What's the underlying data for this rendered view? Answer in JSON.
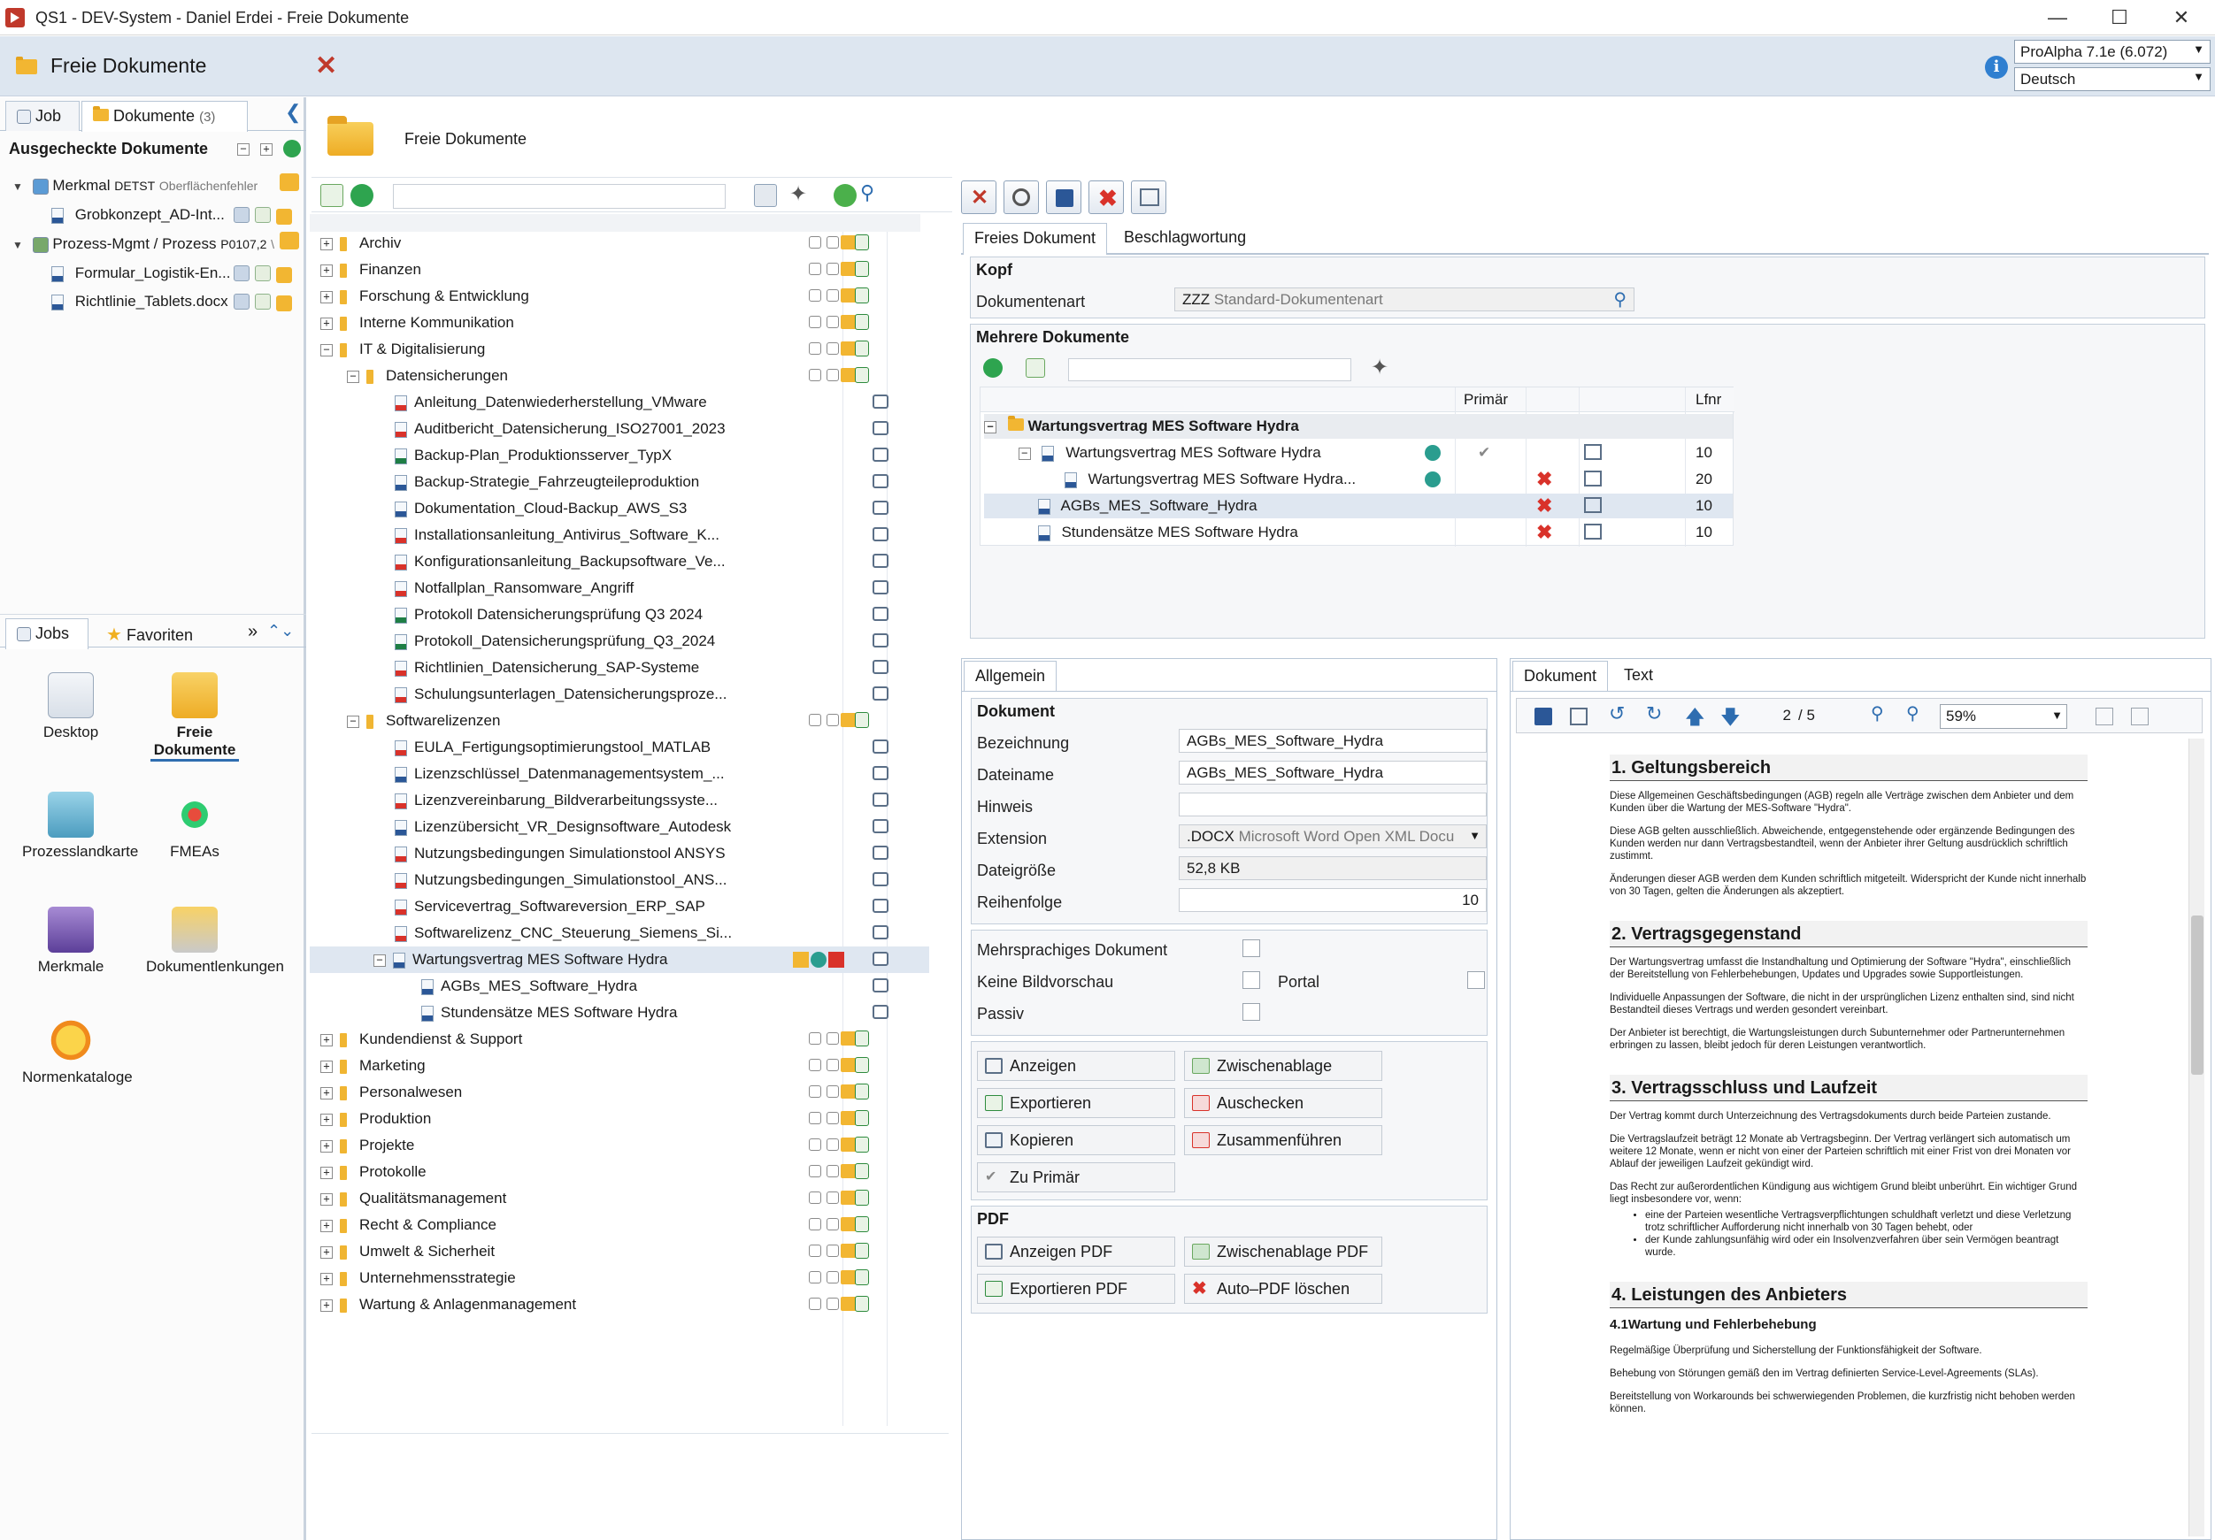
{
  "window": {
    "title": "QS1 - DEV-System - Daniel Erdei - Freie Dokumente"
  },
  "header": {
    "title": "Freie Dokumente",
    "version": "ProAlpha 7.1e (6.072)",
    "language": "Deutsch"
  },
  "left": {
    "tabs": {
      "job": "Job",
      "documents": "Dokumente",
      "documents_count": "(3)"
    },
    "checked_out_title": "Ausgecheckte Dokumente",
    "checked_out": [
      {
        "label": "Merkmal",
        "code": "DETST",
        "note": "Oberflächenfehler"
      },
      {
        "label": "Grobkonzept_AD-Int..."
      },
      {
        "label": "Prozess-Mgmt / Prozess",
        "code": "P0107,2",
        "note": "\\"
      },
      {
        "label": "Formular_Logistik-En..."
      },
      {
        "label": "Richtlinie_Tablets.docx"
      }
    ],
    "bottom_tabs": {
      "jobs": "Jobs",
      "favorites": "Favoriten",
      "more": "»"
    },
    "launchers": {
      "desktop": "Desktop",
      "freie": "Freie Dokumente",
      "prozess": "Prozesslandkarte",
      "fmeas": "FMEAs",
      "merkmale": "Merkmale",
      "doclinks": "Dokumentlenkungen",
      "normen": "Normenkataloge"
    }
  },
  "mid": {
    "title": "Freie Dokumente",
    "tree": [
      {
        "label": "Archiv",
        "kind": "folder",
        "level": 0,
        "exp": "+"
      },
      {
        "label": "Finanzen",
        "kind": "folder",
        "level": 0,
        "exp": "+"
      },
      {
        "label": "Forschung & Entwicklung",
        "kind": "folder",
        "level": 0,
        "exp": "+"
      },
      {
        "label": "Interne Kommunikation",
        "kind": "folder",
        "level": 0,
        "exp": "+"
      },
      {
        "label": "IT & Digitalisierung",
        "kind": "folder",
        "level": 0,
        "exp": "−"
      },
      {
        "label": "Datensicherungen",
        "kind": "folder",
        "level": 1,
        "exp": "−"
      },
      {
        "label": "Anleitung_Datenwiederherstellung_VMware",
        "kind": "pdf",
        "level": 2
      },
      {
        "label": "Auditbericht_Datensicherung_ISO27001_2023",
        "kind": "pdf",
        "level": 2
      },
      {
        "label": "Backup-Plan_Produktionsserver_TypX",
        "kind": "xls",
        "level": 2
      },
      {
        "label": "Backup-Strategie_Fahrzeugteileproduktion",
        "kind": "docx",
        "level": 2
      },
      {
        "label": "Dokumentation_Cloud-Backup_AWS_S3",
        "kind": "docx",
        "level": 2
      },
      {
        "label": "Installationsanleitung_Antivirus_Software_K...",
        "kind": "pdf",
        "level": 2
      },
      {
        "label": "Konfigurationsanleitung_Backupsoftware_Ve...",
        "kind": "pdf",
        "level": 2
      },
      {
        "label": "Notfallplan_Ransomware_Angriff",
        "kind": "pdf",
        "level": 2
      },
      {
        "label": "Protokoll Datensicherungsprüfung Q3 2024",
        "kind": "xls",
        "level": 2
      },
      {
        "label": "Protokoll_Datensicherungsprüfung_Q3_2024",
        "kind": "xls",
        "level": 2
      },
      {
        "label": "Richtlinien_Datensicherung_SAP-Systeme",
        "kind": "pdf",
        "level": 2
      },
      {
        "label": "Schulungsunterlagen_Datensicherungsproze...",
        "kind": "pdf",
        "level": 2
      },
      {
        "label": "Softwarelizenzen",
        "kind": "folder",
        "level": 1,
        "exp": "−"
      },
      {
        "label": "EULA_Fertigungsoptimierungstool_MATLAB",
        "kind": "pdf",
        "level": 2
      },
      {
        "label": "Lizenzschlüssel_Datenmanagementsystem_...",
        "kind": "docx",
        "level": 2
      },
      {
        "label": "Lizenzvereinbarung_Bildverarbeitungssyste...",
        "kind": "pdf",
        "level": 2
      },
      {
        "label": "Lizenzübersicht_VR_Designsoftware_Autodesk",
        "kind": "docx",
        "level": 2
      },
      {
        "label": "Nutzungsbedingungen Simulationstool ANSYS",
        "kind": "pdf",
        "level": 2
      },
      {
        "label": "Nutzungsbedingungen_Simulationstool_ANS...",
        "kind": "pdf",
        "level": 2
      },
      {
        "label": "Servicevertrag_Softwareversion_ERP_SAP",
        "kind": "pdf",
        "level": 2
      },
      {
        "label": "Softwarelizenz_CNC_Steuerung_Siemens_Si...",
        "kind": "pdf",
        "level": 2
      },
      {
        "label": "Wartungsvertrag MES Software Hydra",
        "kind": "docx",
        "level": 2,
        "exp": "−",
        "selected": true
      },
      {
        "label": "AGBs_MES_Software_Hydra",
        "kind": "docx",
        "level": 3
      },
      {
        "label": "Stundensätze MES Software Hydra",
        "kind": "docx",
        "level": 3
      },
      {
        "label": "Kundendienst & Support",
        "kind": "folder",
        "level": 0,
        "exp": "+"
      },
      {
        "label": "Marketing",
        "kind": "folder",
        "level": 0,
        "exp": "+"
      },
      {
        "label": "Personalwesen",
        "kind": "folder",
        "level": 0,
        "exp": "+"
      },
      {
        "label": "Produktion",
        "kind": "folder",
        "level": 0,
        "exp": "+"
      },
      {
        "label": "Projekte",
        "kind": "folder",
        "level": 0,
        "exp": "+"
      },
      {
        "label": "Protokolle",
        "kind": "folder",
        "level": 0,
        "exp": "+"
      },
      {
        "label": "Qualitätsmanagement",
        "kind": "folder",
        "level": 0,
        "exp": "+"
      },
      {
        "label": "Recht & Compliance",
        "kind": "folder",
        "level": 0,
        "exp": "+"
      },
      {
        "label": "Umwelt & Sicherheit",
        "kind": "folder",
        "level": 0,
        "exp": "+"
      },
      {
        "label": "Unternehmensstrategie",
        "kind": "folder",
        "level": 0,
        "exp": "+"
      },
      {
        "label": "Wartung & Anlagenmanagement",
        "kind": "folder",
        "level": 0,
        "exp": "+"
      }
    ]
  },
  "right": {
    "tabs": {
      "free": "Freies Dokument",
      "tagging": "Beschlagwortung"
    },
    "kopf": {
      "title": "Kopf",
      "doctype_label": "Dokumentenart",
      "doctype_code": "ZZZ",
      "doctype_value": "Standard-Dokumentenart"
    },
    "multi": {
      "title": "Mehrere Dokumente",
      "col_primary": "Primär",
      "col_lfnr": "Lfnr",
      "rows": [
        {
          "label": "Wartungsvertrag MES Software Hydra",
          "lfnr": ""
        },
        {
          "label": "Wartungsvertrag MES Software Hydra",
          "lfnr": "10"
        },
        {
          "label": "Wartungsvertrag MES Software Hydra...",
          "lfnr": "20"
        },
        {
          "label": "AGBs_MES_Software_Hydra",
          "lfnr": "10"
        },
        {
          "label": "Stundensätze MES Software Hydra",
          "lfnr": "10"
        }
      ]
    },
    "general": {
      "tab": "Allgemein",
      "section": "Dokument",
      "bezeichnung_label": "Bezeichnung",
      "bezeichnung": "AGBs_MES_Software_Hydra",
      "dateiname_label": "Dateiname",
      "dateiname": "AGBs_MES_Software_Hydra",
      "hinweis_label": "Hinweis",
      "hinweis": "",
      "extension_label": "Extension",
      "extension_code": ".DOCX",
      "extension_desc": "Microsoft Word Open XML Docu",
      "size_label": "Dateigröße",
      "size": "52,8 KB",
      "order_label": "Reihenfolge",
      "order": "10",
      "multilang_label": "Mehrsprachiges Dokument",
      "nopreview_label": "Keine Bildvorschau",
      "portal_label": "Portal",
      "passive_label": "Passiv",
      "buttons": {
        "show": "Anzeigen",
        "clipboard": "Zwischenablage",
        "export": "Exportieren",
        "checkout": "Auschecken",
        "copy": "Kopieren",
        "merge": "Zusammenführen",
        "primary": "Zu Primär"
      },
      "pdf_section": "PDF",
      "pdf_buttons": {
        "show": "Anzeigen PDF",
        "clipboard": "Zwischenablage PDF",
        "export": "Exportieren PDF",
        "delete": "Auto–PDF löschen"
      }
    },
    "preview": {
      "tab_doc": "Dokument",
      "tab_text": "Text",
      "page": "2",
      "pages": "/ 5",
      "zoom": "59%",
      "sections": [
        {
          "h": "1. Geltungsbereich",
          "p": [
            "Diese Allgemeinen Geschäftsbedingungen (AGB) regeln alle Verträge zwischen dem Anbieter und dem Kunden über die Wartung der MES-Software \"Hydra\".",
            "Diese AGB gelten ausschließlich. Abweichende, entgegenstehende oder ergänzende Bedingungen des Kunden werden nur dann Vertragsbestandteil, wenn der Anbieter ihrer Geltung ausdrücklich schriftlich zustimmt.",
            "Änderungen dieser AGB werden dem Kunden schriftlich mitgeteilt. Widerspricht der Kunde nicht innerhalb von 30 Tagen, gelten die Änderungen als akzeptiert."
          ]
        },
        {
          "h": "2. Vertragsgegenstand",
          "p": [
            "Der Wartungsvertrag umfasst die Instandhaltung und Optimierung der Software \"Hydra\", einschließlich der Bereitstellung von Fehlerbehebungen, Updates und Upgrades sowie Supportleistungen.",
            "Individuelle Anpassungen der Software, die nicht in der ursprünglichen Lizenz enthalten sind, sind nicht Bestandteil dieses Vertrags und werden gesondert vereinbart.",
            "Der Anbieter ist berechtigt, die Wartungsleistungen durch Subunternehmer oder Partnerunternehmen erbringen zu lassen, bleibt jedoch für deren Leistungen verantwortlich."
          ]
        },
        {
          "h": "3. Vertragsschluss und Laufzeit",
          "p": [
            "Der Vertrag kommt durch Unterzeichnung des Vertragsdokuments durch beide Parteien zustande.",
            "Die Vertragslaufzeit beträgt 12 Monate ab Vertragsbeginn. Der Vertrag verlängert sich automatisch um weitere 12 Monate, wenn er nicht von einer der Parteien schriftlich mit einer Frist von drei Monaten vor Ablauf der jeweiligen Laufzeit gekündigt wird.",
            "Das Recht zur außerordentlichen Kündigung aus wichtigem Grund bleibt unberührt. Ein wichtiger Grund liegt insbesondere vor, wenn:"
          ],
          "li": [
            "eine der Parteien wesentliche Vertragsverpflichtungen schuldhaft verletzt und diese Verletzung trotz schriftlicher Aufforderung nicht innerhalb von 30 Tagen behebt, oder",
            "der Kunde zahlungsunfähig wird oder ein Insolvenzverfahren über sein Vermögen beantragt wurde."
          ]
        },
        {
          "h": "4. Leistungen des Anbieters",
          "sub": "4.1Wartung und Fehlerbehebung",
          "p": [
            "Regelmäßige Überprüfung und Sicherstellung der Funktionsfähigkeit der Software.",
            "Behebung von Störungen gemäß den im Vertrag definierten Service-Level-Agreements (SLAs).",
            "Bereitstellung von Workarounds bei schwerwiegenden Problemen, die kurzfristig nicht behoben werden können."
          ]
        }
      ]
    }
  }
}
